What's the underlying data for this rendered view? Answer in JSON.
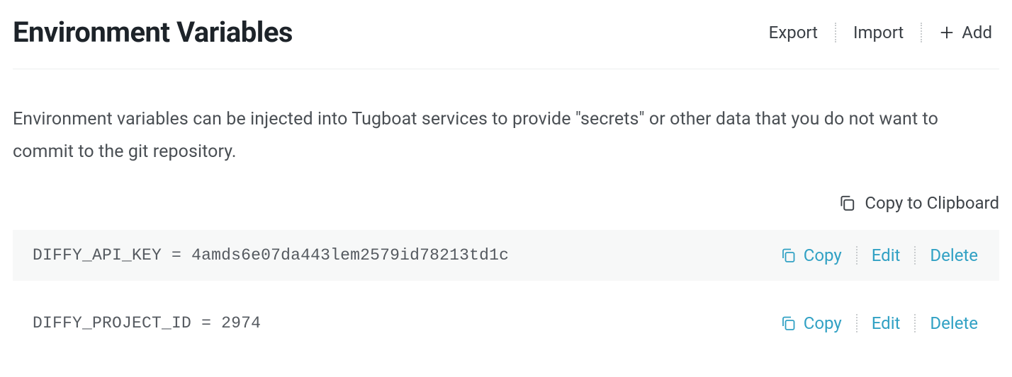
{
  "header": {
    "title": "Environment Variables",
    "export_label": "Export",
    "import_label": "Import",
    "add_label": "Add"
  },
  "description": "Environment variables can be injected into Tugboat services to provide \"secrets\" or other data that you do not want to commit to the git repository.",
  "copy_all_label": "Copy to Clipboard",
  "actions": {
    "copy": "Copy",
    "edit": "Edit",
    "delete": "Delete"
  },
  "rows": [
    {
      "key": "DIFFY_API_KEY",
      "value": "4amds6e07da443lem2579id78213td1c"
    },
    {
      "key": "DIFFY_PROJECT_ID",
      "value": "2974"
    }
  ],
  "colors": {
    "link": "#31a1c4"
  }
}
